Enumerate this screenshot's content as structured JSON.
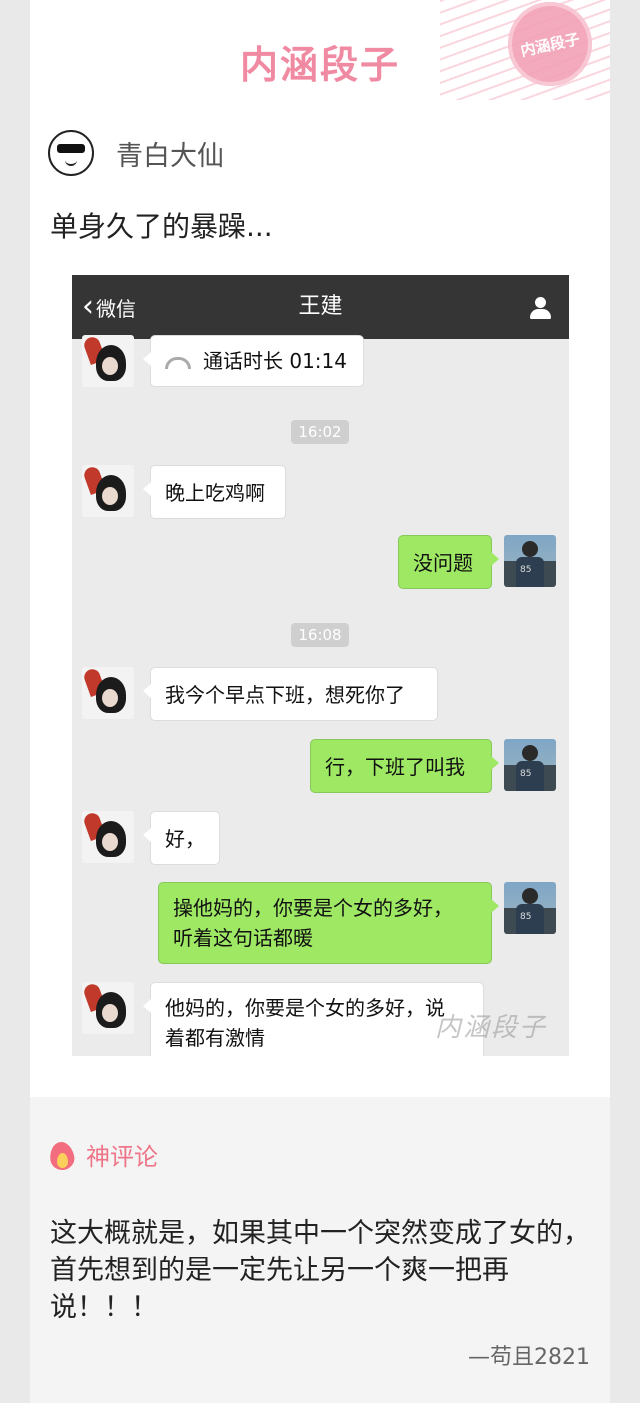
{
  "header": {
    "brand": "内涵段子",
    "stamp_text": "内涵段子"
  },
  "post": {
    "author": "青白大仙",
    "title": "单身久了的暴躁..."
  },
  "chat": {
    "back_label": "微信",
    "contact": "王建",
    "watermark": "内涵段子",
    "call_text": "通话时长 01:14",
    "times": [
      "16:02",
      "16:08"
    ],
    "messages": [
      {
        "side": "left",
        "text": "晚上吃鸡啊"
      },
      {
        "side": "right",
        "text": "没问题"
      },
      {
        "side": "left",
        "text": "我今个早点下班，想死你了"
      },
      {
        "side": "right",
        "text": "行，下班了叫我"
      },
      {
        "side": "left",
        "text": "好，"
      },
      {
        "side": "right",
        "text": "操他妈的，你要是个女的多好，\n听着这句话都暖"
      },
      {
        "side": "left",
        "text": "他妈的，你要是个女的多好，说\n着都有激情"
      }
    ]
  },
  "comments": {
    "label": "神评论",
    "text": "这大概就是，如果其中一个突然变成了女的，首先想到的是一定先让另一个爽一把再说！！！",
    "author": "—苟且2821"
  },
  "colors": {
    "accent_pink": "#f08aa2",
    "bubble_green": "#9ee864",
    "nav_dark": "#353535"
  }
}
